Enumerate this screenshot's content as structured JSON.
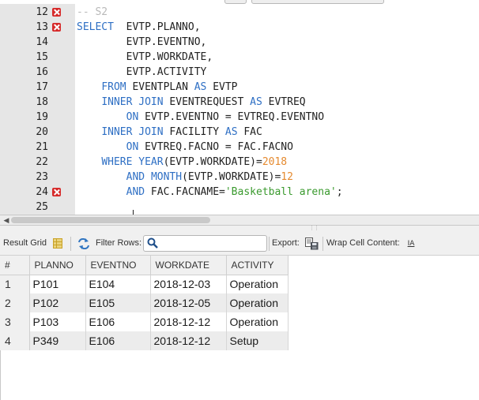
{
  "editor": {
    "lines": [
      {
        "no": "12",
        "error": true,
        "segments": [
          {
            "t": "-- S2",
            "c": "cm"
          }
        ]
      },
      {
        "no": "13",
        "error": true,
        "segments": [
          {
            "t": "SELECT",
            "c": "kw"
          },
          {
            "t": "  EVTP.PLANNO,",
            "c": ""
          }
        ]
      },
      {
        "no": "14",
        "error": false,
        "segments": [
          {
            "t": "        EVTP.EVENTNO,",
            "c": ""
          }
        ]
      },
      {
        "no": "15",
        "error": false,
        "segments": [
          {
            "t": "        EVTP.WORKDATE,",
            "c": ""
          }
        ]
      },
      {
        "no": "16",
        "error": false,
        "segments": [
          {
            "t": "        EVTP.ACTIVITY",
            "c": ""
          }
        ]
      },
      {
        "no": "17",
        "error": false,
        "segments": [
          {
            "t": "    ",
            "c": ""
          },
          {
            "t": "FROM",
            "c": "kw"
          },
          {
            "t": " EVENTPLAN ",
            "c": ""
          },
          {
            "t": "AS",
            "c": "kw"
          },
          {
            "t": " EVTP",
            "c": ""
          }
        ]
      },
      {
        "no": "18",
        "error": false,
        "segments": [
          {
            "t": "    ",
            "c": ""
          },
          {
            "t": "INNER JOIN",
            "c": "kw"
          },
          {
            "t": " EVENTREQUEST ",
            "c": ""
          },
          {
            "t": "AS",
            "c": "kw"
          },
          {
            "t": " EVTREQ",
            "c": ""
          }
        ]
      },
      {
        "no": "19",
        "error": false,
        "segments": [
          {
            "t": "        ",
            "c": ""
          },
          {
            "t": "ON",
            "c": "kw"
          },
          {
            "t": " EVTP.EVENTNO = EVTREQ.EVENTNO",
            "c": ""
          }
        ]
      },
      {
        "no": "20",
        "error": false,
        "segments": [
          {
            "t": "    ",
            "c": ""
          },
          {
            "t": "INNER JOIN",
            "c": "kw"
          },
          {
            "t": " FACILITY ",
            "c": ""
          },
          {
            "t": "AS",
            "c": "kw"
          },
          {
            "t": " FAC",
            "c": ""
          }
        ]
      },
      {
        "no": "21",
        "error": false,
        "segments": [
          {
            "t": "        ",
            "c": ""
          },
          {
            "t": "ON",
            "c": "kw"
          },
          {
            "t": " EVTREQ.FACNO = FAC.FACNO",
            "c": ""
          }
        ]
      },
      {
        "no": "22",
        "error": false,
        "segments": [
          {
            "t": "    ",
            "c": ""
          },
          {
            "t": "WHERE",
            "c": "kw"
          },
          {
            "t": " ",
            "c": ""
          },
          {
            "t": "YEAR",
            "c": "kw"
          },
          {
            "t": "(EVTP.WORKDATE)=",
            "c": ""
          },
          {
            "t": "2018",
            "c": "num"
          }
        ]
      },
      {
        "no": "23",
        "error": false,
        "segments": [
          {
            "t": "        ",
            "c": ""
          },
          {
            "t": "AND",
            "c": "kw"
          },
          {
            "t": " ",
            "c": ""
          },
          {
            "t": "MONTH",
            "c": "kw"
          },
          {
            "t": "(EVTP.WORKDATE)=",
            "c": ""
          },
          {
            "t": "12",
            "c": "num"
          }
        ]
      },
      {
        "no": "24",
        "error": true,
        "segments": [
          {
            "t": "        ",
            "c": ""
          },
          {
            "t": "AND",
            "c": "kw"
          },
          {
            "t": " FAC.FACNAME=",
            "c": ""
          },
          {
            "t": "'Basketball arena'",
            "c": "str"
          },
          {
            "t": ";",
            "c": ""
          }
        ]
      },
      {
        "no": "25",
        "error": false,
        "segments": []
      }
    ]
  },
  "toolbar": {
    "result_grid_label": "Result Grid",
    "filter_rows_label": "Filter Rows:",
    "filter_value": "",
    "export_label": "Export:",
    "wrap_label": "Wrap Cell Content:",
    "wrap_icon_text": "IA"
  },
  "grid": {
    "columns": [
      "#",
      "PLANNO",
      "EVENTNO",
      "WORKDATE",
      "ACTIVITY"
    ],
    "rows": [
      [
        "1",
        "P101",
        "E104",
        "2018-12-03",
        "Operation"
      ],
      [
        "2",
        "P102",
        "E105",
        "2018-12-05",
        "Operation"
      ],
      [
        "3",
        "P103",
        "E106",
        "2018-12-12",
        "Operation"
      ],
      [
        "4",
        "P349",
        "E106",
        "2018-12-12",
        "Setup"
      ]
    ]
  },
  "colors": {
    "keyword": "#2e6fc4",
    "comment": "#b9b9b9",
    "number": "#e58a2f",
    "string": "#3a9a2e",
    "error_marker": "#d62a2a"
  }
}
